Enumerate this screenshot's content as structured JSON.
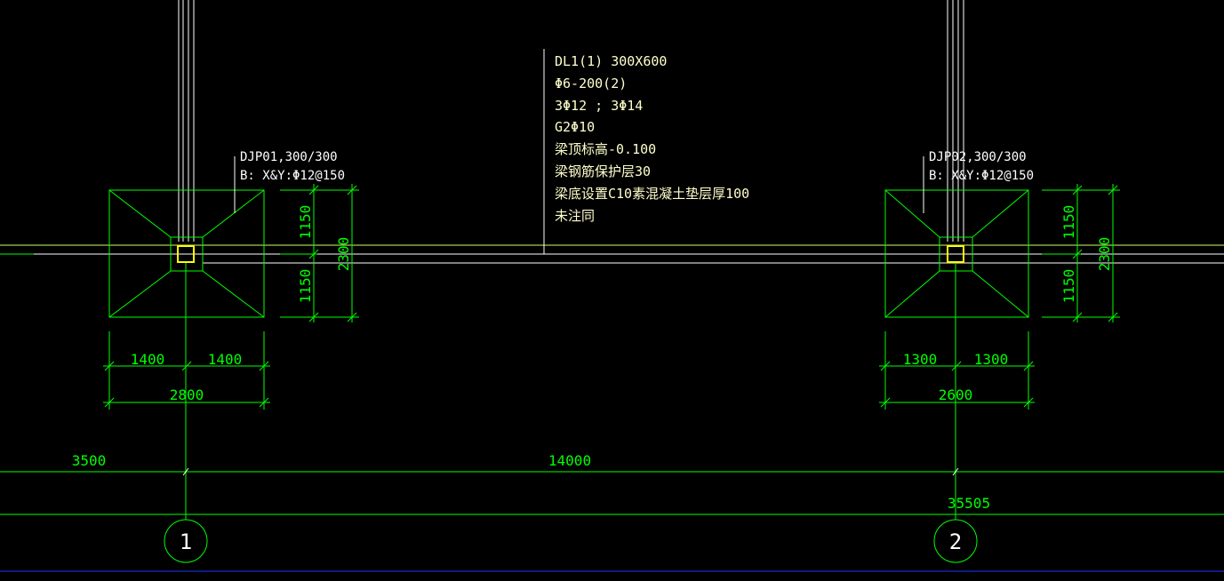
{
  "beam_note": {
    "lines": [
      "DL1(1) 300X600",
      "Φ6-200(2)",
      "3Φ12 ; 3Φ14",
      "G2Φ10",
      "梁顶标高-0.100",
      "梁钢筋保护层30",
      "梁底设置C10素混凝土垫层厚100",
      "未注同"
    ]
  },
  "footing_1": {
    "label_line1": "DJP01,300/300",
    "label_line2": "B: X&Y:Φ12@150",
    "dim_left": "1400",
    "dim_right": "1400",
    "dim_total_width": "2800",
    "dim_upper": "1150",
    "dim_lower": "1150",
    "dim_total_height": "2300"
  },
  "footing_2": {
    "label_line1": "DJP02,300/300",
    "label_line2": "B: X&Y:Φ12@150",
    "dim_left": "1300",
    "dim_right": "1300",
    "dim_total_width": "2600",
    "dim_upper": "1150",
    "dim_lower": "1150",
    "dim_total_height": "2300"
  },
  "grid_dims": {
    "left_span": "3500",
    "middle_span": "14000",
    "right_value": "35505"
  },
  "axes": [
    "1",
    "2"
  ],
  "colors": {
    "background": "#000000",
    "dimension": "#00ff00",
    "column": "#ffff00",
    "outline": "#ffffff"
  }
}
